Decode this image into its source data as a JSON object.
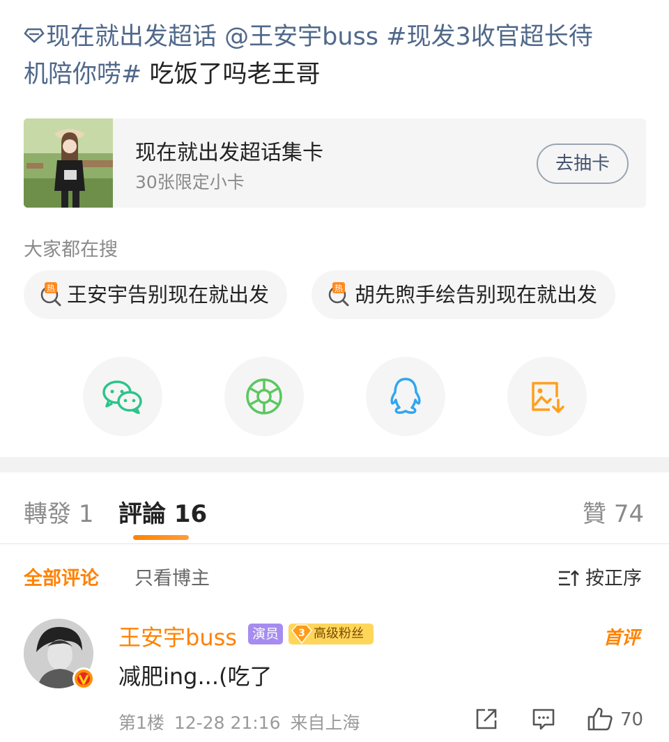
{
  "post": {
    "topic_link": "现在就出发超话",
    "mention": "@王安宇buss",
    "hashtag_line1": "#现发3收官超长待",
    "hashtag_line2": "机陪你唠#",
    "text": "吃饭了吗老王哥"
  },
  "card": {
    "title": "现在就出发超话集卡",
    "subtitle": "30张限定小卡",
    "button": "去抽卡"
  },
  "search": {
    "label": "大家都在搜",
    "hot_badge": "热",
    "chips": [
      "王安宇告别现在就出发",
      "胡先煦手绘告别现在就出发"
    ]
  },
  "share": {
    "icons": [
      "wechat-icon",
      "moments-icon",
      "qq-icon",
      "save-image-icon"
    ],
    "colors": {
      "wechat": "#2bc48b",
      "moments": "#5bc75f",
      "qq": "#32a6ee",
      "save": "#ff9f1a"
    }
  },
  "tabs": {
    "repost_label": "轉發",
    "repost_count": "1",
    "comment_label": "評論",
    "comment_count": "16",
    "like_label": "贊",
    "like_count": "74"
  },
  "filters": {
    "all": "全部评论",
    "author_only": "只看博主",
    "sort": "按正序"
  },
  "comment": {
    "username": "王安宇buss",
    "role_badge": "演员",
    "fan_level": "3",
    "fan_badge": "高级粉丝",
    "first_tag": "首评",
    "text": "减肥ing...(吃了",
    "floor": "第1楼",
    "time": "12-28 21:16",
    "location": "来自上海",
    "likes": "70"
  },
  "colors": {
    "accent": "#ff8200",
    "link": "#50688a"
  }
}
